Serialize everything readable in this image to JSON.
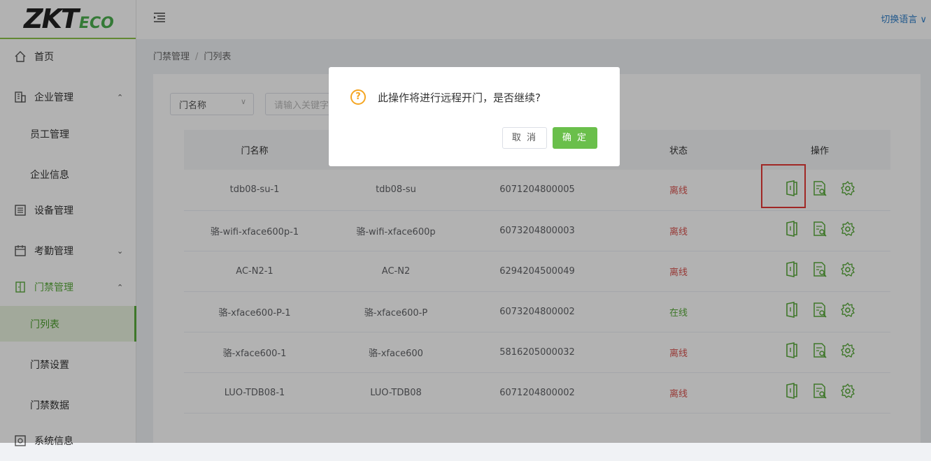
{
  "logo": {
    "main": "ZKT",
    "eco": "ECO"
  },
  "header": {
    "language_switch": "切换语言 ∨"
  },
  "sidebar": {
    "items": [
      {
        "label": "首页"
      },
      {
        "label": "企业管理",
        "caret": "⌃"
      },
      {
        "label": "员工管理"
      },
      {
        "label": "企业信息"
      },
      {
        "label": "设备管理"
      },
      {
        "label": "考勤管理",
        "caret": "⌄"
      },
      {
        "label": "门禁管理",
        "caret": "⌃"
      },
      {
        "label": "门列表"
      },
      {
        "label": "门禁设置"
      },
      {
        "label": "门禁数据"
      },
      {
        "label": "系统信息"
      }
    ]
  },
  "breadcrumb": {
    "parent": "门禁管理",
    "separator": "/",
    "current": "门列表"
  },
  "filter": {
    "select_value": "门名称",
    "search_placeholder": "请输入关键字"
  },
  "table": {
    "headers": [
      "门名称",
      "",
      "",
      "状态",
      "操作"
    ],
    "rows": [
      {
        "door": "tdb08-su-1",
        "device": "tdb08-su",
        "sn": "6071204800005",
        "status": "离线",
        "online": false
      },
      {
        "door": "骆-wifi-xface600p-1",
        "device": "骆-wifi-xface600p",
        "sn": "6073204800003",
        "status": "离线",
        "online": false
      },
      {
        "door": "AC-N2-1",
        "device": "AC-N2",
        "sn": "6294204500049",
        "status": "离线",
        "online": false
      },
      {
        "door": "骆-xface600-P-1",
        "device": "骆-xface600-P",
        "sn": "6073204800002",
        "status": "在线",
        "online": true
      },
      {
        "door": "骆-xface600-1",
        "device": "骆-xface600",
        "sn": "5816205000032",
        "status": "离线",
        "online": false
      },
      {
        "door": "LUO-TDB08-1",
        "device": "LUO-TDB08",
        "sn": "6071204800002",
        "status": "离线",
        "online": false
      }
    ]
  },
  "dialog": {
    "icon": "question-icon",
    "message": "此操作将进行远程开门，是否继续?",
    "cancel_label": "取 消",
    "ok_label": "确 定"
  },
  "colors": {
    "accent": "#5aab3b",
    "offline": "#d9534f",
    "warning": "#f5a623",
    "link": "#2e7ec9"
  }
}
